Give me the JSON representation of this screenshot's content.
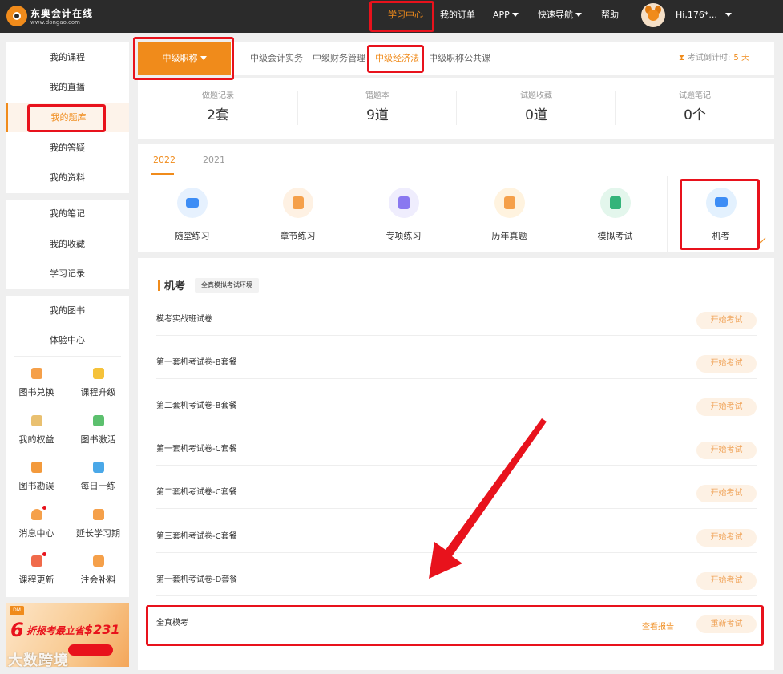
{
  "header": {
    "brand": "东奥会计在线",
    "brand_sub": "www.dongao.com",
    "nav": [
      {
        "label": "学习中心",
        "active": true
      },
      {
        "label": "我的订单"
      },
      {
        "label": "APP"
      },
      {
        "label": "快速导航"
      },
      {
        "label": "帮助"
      }
    ],
    "user": "Hi,176*..."
  },
  "sidebar": {
    "group1": [
      "我的课程",
      "我的直播",
      "我的题库",
      "我的答疑",
      "我的资料"
    ],
    "group2": [
      "我的笔记",
      "我的收藏",
      "学习记录"
    ],
    "group3": [
      "我的图书",
      "体验中心"
    ],
    "grid": [
      {
        "label": "图书兑换",
        "icon": "exchange-icon",
        "color": "#f5a04a"
      },
      {
        "label": "课程升级",
        "icon": "upgrade-icon",
        "color": "#f5c23a"
      },
      {
        "label": "我的权益",
        "icon": "crown-icon",
        "color": "#e9c070"
      },
      {
        "label": "图书激活",
        "icon": "activate-icon",
        "color": "#5cc06e"
      },
      {
        "label": "图书勘误",
        "icon": "book-icon",
        "color": "#f39a3c"
      },
      {
        "label": "每日一练",
        "icon": "practice-icon",
        "color": "#4aa8e8"
      },
      {
        "label": "消息中心",
        "icon": "bell-icon",
        "color": "#f5a04a",
        "dot": true
      },
      {
        "label": "延长学习期",
        "icon": "calendar-icon",
        "color": "#f5a04a"
      },
      {
        "label": "课程更新",
        "icon": "play-icon",
        "color": "#f06a4a",
        "dot": true
      },
      {
        "label": "注会补料",
        "icon": "package-icon",
        "color": "#f5a04a"
      }
    ],
    "promo": {
      "tag": "DM",
      "six": "6",
      "text": "折报考最立省",
      "price": "$231"
    }
  },
  "watermark": "大数跨境",
  "subjects": {
    "level_button": "中级职称",
    "tabs": [
      {
        "label": "中级会计实务"
      },
      {
        "label": "中级财务管理"
      },
      {
        "label": "中级经济法",
        "active": true
      },
      {
        "label": "中级职称公共课"
      }
    ],
    "countdown_label": "考试倒计时:",
    "countdown_value": "5 天"
  },
  "stats": [
    {
      "label": "做题记录",
      "value": "2套"
    },
    {
      "label": "错题本",
      "value": "9道"
    },
    {
      "label": "试题收藏",
      "value": "0道"
    },
    {
      "label": "试题笔记",
      "value": "0个"
    }
  ],
  "years": [
    {
      "label": "2022",
      "active": true
    },
    {
      "label": "2021"
    }
  ],
  "categories": [
    {
      "label": "随堂练习",
      "icon": "video-icon",
      "color": "#3d8df5",
      "bg": "#e6f1fe"
    },
    {
      "label": "章节练习",
      "icon": "chapter-icon",
      "color": "#f5a04a",
      "bg": "#fef1e3"
    },
    {
      "label": "专项练习",
      "icon": "special-icon",
      "color": "#8a78f0",
      "bg": "#efedfd"
    },
    {
      "label": "历年真题",
      "icon": "star-doc-icon",
      "color": "#f5a04a",
      "bg": "#fff3df"
    },
    {
      "label": "模拟考试",
      "icon": "mock-icon",
      "color": "#34b47a",
      "bg": "#e3f6ec"
    },
    {
      "label": "机考",
      "icon": "computer-icon",
      "color": "#3d8df5",
      "bg": "#e3f1fe",
      "active": true
    }
  ],
  "exams": {
    "title": "机考",
    "badge": "全真模拟考试环境",
    "items": [
      {
        "name": "模考实战班试卷",
        "action": "开始考试"
      },
      {
        "name": "第一套机考试卷-B套餐",
        "action": "开始考试"
      },
      {
        "name": "第二套机考试卷-B套餐",
        "action": "开始考试"
      },
      {
        "name": "第一套机考试卷-C套餐",
        "action": "开始考试"
      },
      {
        "name": "第二套机考试卷-C套餐",
        "action": "开始考试"
      },
      {
        "name": "第三套机考试卷-C套餐",
        "action": "开始考试"
      },
      {
        "name": "第一套机考试卷-D套餐",
        "action": "开始考试"
      },
      {
        "name": "全真模考",
        "action": "重新考试",
        "report": "查看报告"
      }
    ]
  }
}
